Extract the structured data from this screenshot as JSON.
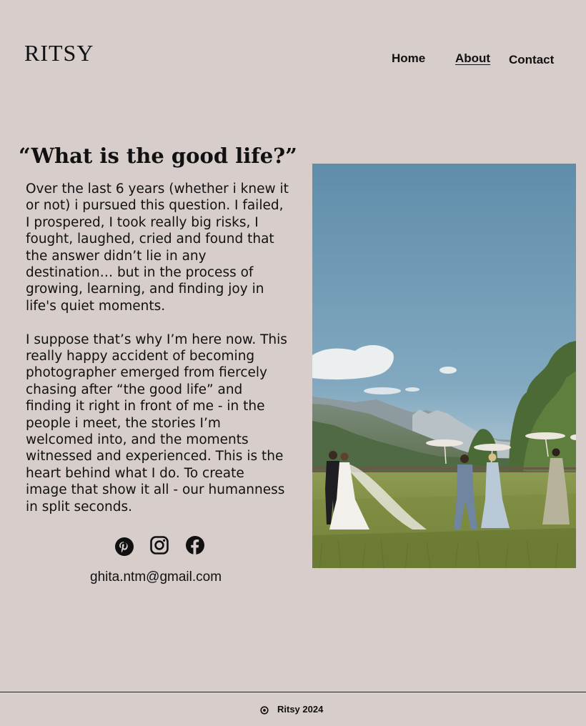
{
  "brand": {
    "logo": "RITSY"
  },
  "nav": {
    "home": "Home",
    "about": "About",
    "contact": "Contact",
    "active": "About"
  },
  "main": {
    "heading": "“What is the good life?”",
    "paragraphs": [
      "Over the last 6 years (whether i knew it\nor not) i pursued this question. I failed,\nI prospered, I took really big risks, I\nfought, laughed, cried and found that\nthe answer didn’t lie in any\ndestination… but in the process of\ngrowing, learning, and finding joy in\nlife's quiet moments.",
      "I suppose that’s why I’m here now. This\nreally happy accident of becoming\nphotographer emerged from fiercely\nchasing after “the good life” and\nfinding it right in front of me - in the\npeople i meet, the stories I’m\nwelcomed into, and the moments\nwitnessed and experienced. This is the\nheart behind what I do. To create\nimage that show it all - our humanness\nin split seconds."
    ],
    "socials": [
      "pinterest-icon",
      "instagram-icon",
      "facebook-icon"
    ],
    "email": "ghita.ntm@gmail.com"
  },
  "footer": {
    "icon": "copyright-icon",
    "text": "Ritsy 2024"
  },
  "colors": {
    "background": "#d7cdca",
    "text": "#111111",
    "sky": "#6f9bb6"
  }
}
